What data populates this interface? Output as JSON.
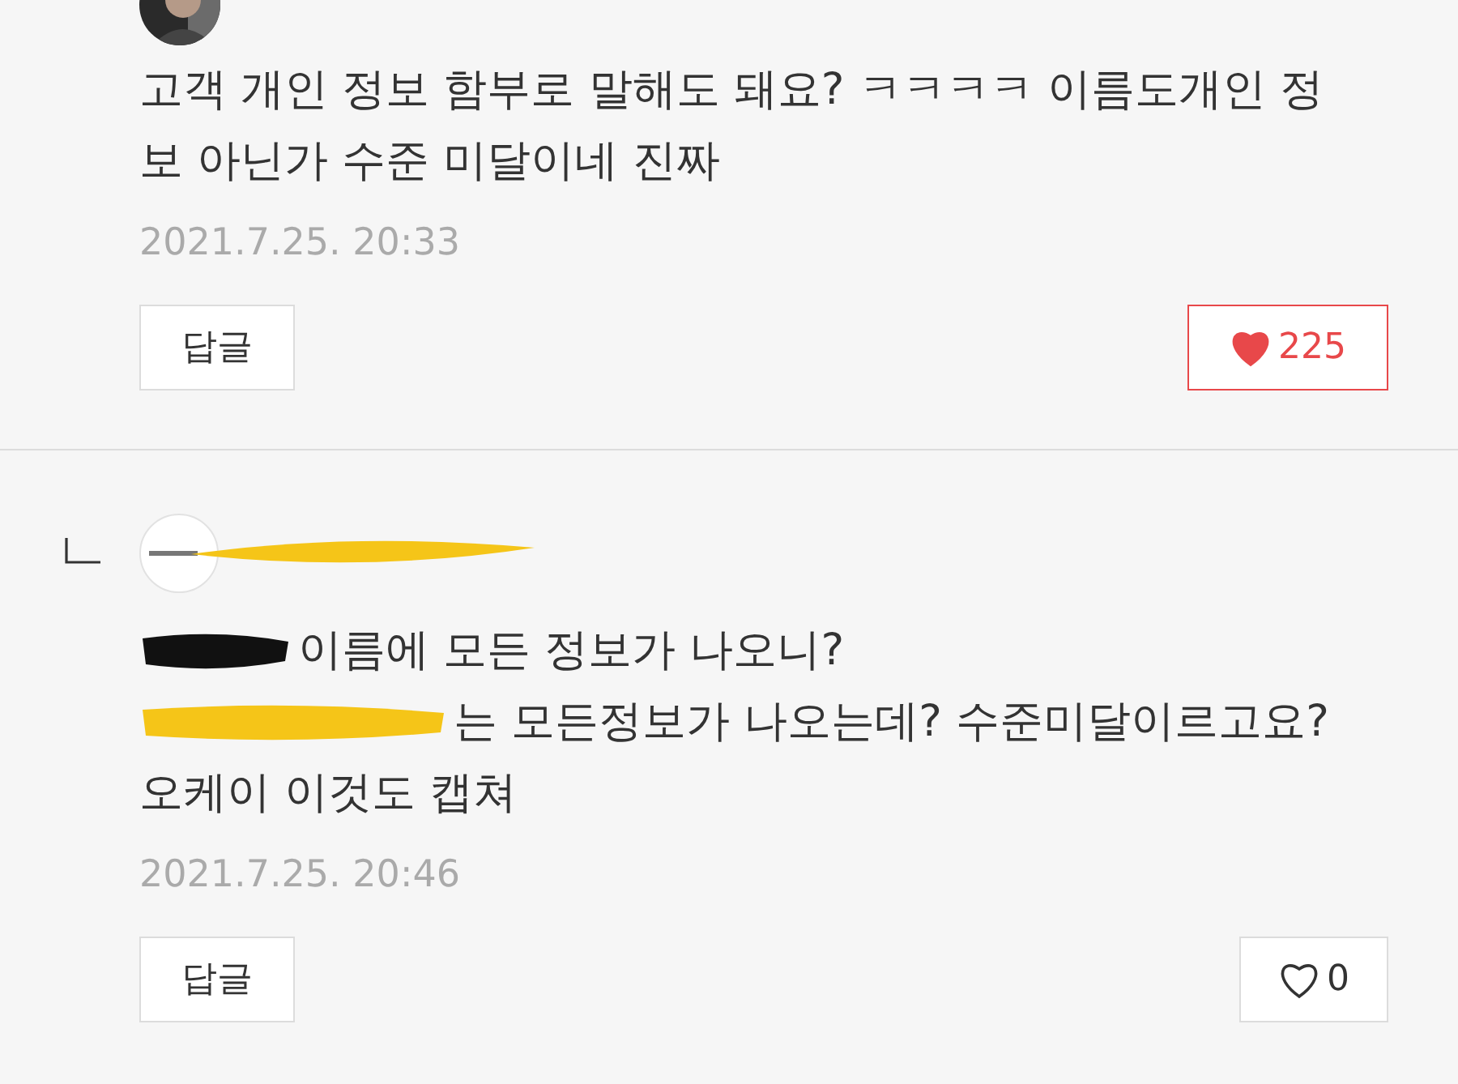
{
  "comments": [
    {
      "kind": "comment",
      "lines": [
        {
          "text": "고객 개인 정보 함부로 말해도 돼요? ㅋㅋㅋㅋ 이름도개인 정"
        },
        {
          "text": "보 아닌가 수준 미달이네 진짜"
        }
      ],
      "date": "2021.7.25. 20:33",
      "reply_button": "답글",
      "likes": {
        "count": "225",
        "liked": true
      }
    },
    {
      "kind": "reply",
      "name_redaction": {
        "color": "#f5c518"
      },
      "lines": [
        {
          "text": "이름에 모든 정보가 나오니?",
          "redaction": {
            "color": "#111111"
          }
        },
        {
          "text": "는 모든정보가 나오는데? 수준미달이르고요?",
          "redaction": {
            "color": "#f5c518"
          }
        },
        {
          "text": "오케이 이것도 캡쳐"
        }
      ],
      "date": "2021.7.25. 20:46",
      "reply_button": "답글",
      "likes": {
        "count": "0",
        "liked": false
      }
    }
  ]
}
